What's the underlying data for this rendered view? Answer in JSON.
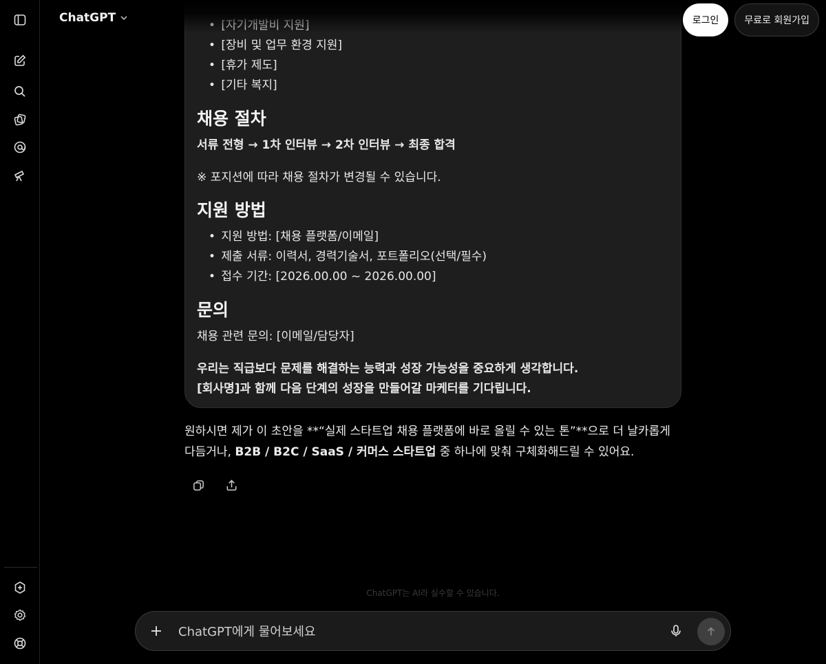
{
  "header": {
    "brand": "ChatGPT",
    "login_label": "로그인",
    "signup_label": "무료로 회원가입"
  },
  "sidebar": {
    "items": [
      {
        "name": "toggle-sidebar"
      },
      {
        "name": "new-chat"
      },
      {
        "name": "search"
      },
      {
        "name": "library"
      },
      {
        "name": "codex"
      },
      {
        "name": "explore"
      }
    ],
    "bottom": [
      {
        "name": "upgrade"
      },
      {
        "name": "settings"
      },
      {
        "name": "help"
      }
    ]
  },
  "card": {
    "bullets_top": [
      "[자기개발비 지원]",
      "[장비 및 업무 환경 지원]",
      "[휴가 제도]",
      "[기타 복지]"
    ],
    "process_heading": "채용 절차",
    "process_flow": "서류 전형 → 1차 인터뷰 → 2차 인터뷰 → 최종 합격",
    "process_note": "※ 포지션에 따라 채용 절차가 변경될 수 있습니다.",
    "apply_heading": "지원 방법",
    "apply_bullets": [
      "지원 방법: [채용 플랫폼/이메일]",
      "제출 서류: 이력서, 경력기술서, 포트폴리오(선택/필수)",
      "접수 기간: [2026.00.00 ~ 2026.00.00]"
    ],
    "contact_heading": "문의",
    "contact_line": "채용 관련 문의: [이메일/담당자]",
    "closing_1": "우리는 직급보다 문제를 해결하는 능력과 성장 가능성을 중요하게 생각합니다.",
    "closing_2": "[회사명]과 함께 다음 단계의 성장을 만들어갈 마케터를 기다립니다."
  },
  "reply": {
    "part1": "원하시면 제가 이 초안을 **“실제 스타트업 채용 플랫폼에 바로 올릴 수 있는 톤”**으로 더 날카롭게 다듬거나, ",
    "part2_bold": "B2B / B2C / SaaS / 커머스 스타트업",
    "part3": " 중 하나에 맞춰 구체화해드릴 수 있어요."
  },
  "footer": {
    "disclaimer": "ChatGPT는 AI라 실수할 수 있습니다.",
    "input_placeholder": "ChatGPT에게 물어보세요"
  }
}
